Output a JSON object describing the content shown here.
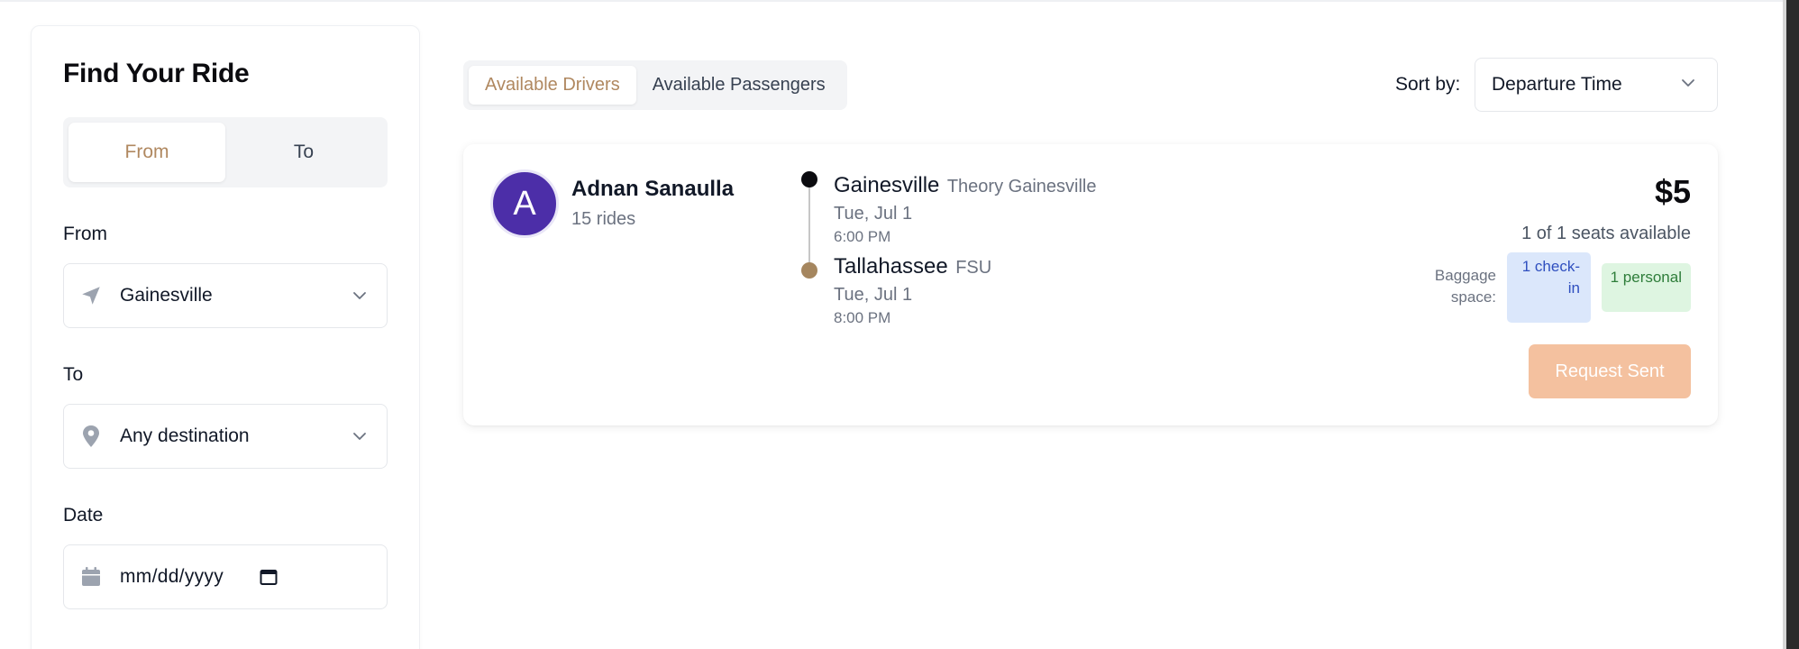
{
  "sidebar": {
    "title": "Find Your Ride",
    "direction_toggle": {
      "from_label": "From",
      "to_label": "To",
      "active": "From"
    },
    "from_field": {
      "label": "From",
      "value": "Gainesville",
      "icon": "location-arrow-icon"
    },
    "to_field": {
      "label": "To",
      "value": "Any destination",
      "icon": "map-pin-icon"
    },
    "date_field": {
      "label": "Date",
      "value": "mm/dd/yyyy",
      "icon": "calendar-icon"
    }
  },
  "tabs": {
    "drivers_label": "Available Drivers",
    "passengers_label": "Available Passengers",
    "active": "Available Drivers"
  },
  "sort": {
    "label": "Sort by:",
    "value": "Departure Time"
  },
  "rides": [
    {
      "avatar_letter": "A",
      "driver_name": "Adnan Sanaulla",
      "rides_count": "15 rides",
      "origin": {
        "city": "Gainesville",
        "place": "Theory Gainesville",
        "date": "Tue, Jul 1",
        "time": "6:00 PM"
      },
      "destination": {
        "city": "Tallahassee",
        "place": "FSU",
        "date": "Tue, Jul 1",
        "time": "8:00 PM"
      },
      "price": "$5",
      "seats": "1 of 1 seats available",
      "baggage_label": "Baggage space:",
      "baggage_checkin": "1 check-in",
      "baggage_personal": "1 personal",
      "request_label": "Request Sent"
    }
  ],
  "colors": {
    "accent": "#b08860",
    "avatar": "#4c2ea8",
    "request_button": "#f4c19f",
    "checkin_badge_bg": "#dbe7fb",
    "personal_badge_bg": "#def5e1"
  }
}
